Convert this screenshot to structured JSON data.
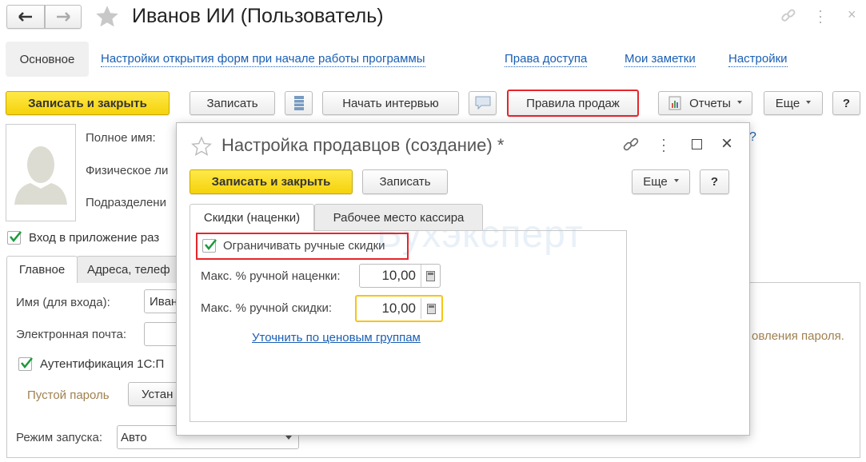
{
  "window": {
    "title": "Иванов ИИ (Пользователь)"
  },
  "nav_tabs": [
    "Основное",
    "Настройки открытия форм при начале работы программы",
    "Права доступа",
    "Мои заметки",
    "Настройки"
  ],
  "toolbar": {
    "save_close": "Записать и закрыть",
    "save": "Записать",
    "interview": "Начать интервью",
    "sales_rules": "Правила продаж",
    "reports": "Отчеты",
    "more": "Еще",
    "help": "?"
  },
  "form": {
    "full_name_label": "Полное имя:",
    "person_label": "Физическое ли",
    "department_label": "Подразделени",
    "login_allowed": "Вход в приложение раз",
    "tabs": [
      "Главное",
      "Адреса, телеф"
    ],
    "login_name_label": "Имя (для входа):",
    "login_name_value": "Иван",
    "email_label": "Электронная почта:",
    "auth_label": "Аутентификация 1С:П",
    "empty_password": "Пустой пароль",
    "set_button": "Устан",
    "launch_mode_label": "Режим запуска:",
    "launch_mode_value": "Авто",
    "password_note": "овления пароля.",
    "help_mark": "?"
  },
  "dialog": {
    "title": "Настройка продавцов (создание) *",
    "save_close": "Записать и закрыть",
    "save": "Записать",
    "more": "Еще",
    "help": "?",
    "tabs": [
      "Скидки (наценки)",
      "Рабочее место кассира"
    ],
    "limit_discounts": "Ограничивать ручные скидки",
    "max_markup_label": "Макс. % ручной наценки:",
    "max_markup_value": "10,00",
    "max_discount_label": "Макс. % ручной скидки:",
    "max_discount_value": "10,00",
    "price_groups_link": "Уточнить по ценовым группам"
  },
  "watermark": "Бухэксперт",
  "colors": {
    "accent_yellow": "#f5d20a",
    "highlight_red": "#e8252b",
    "focus_orange": "#f5c518",
    "link": "#1a5fb4"
  }
}
